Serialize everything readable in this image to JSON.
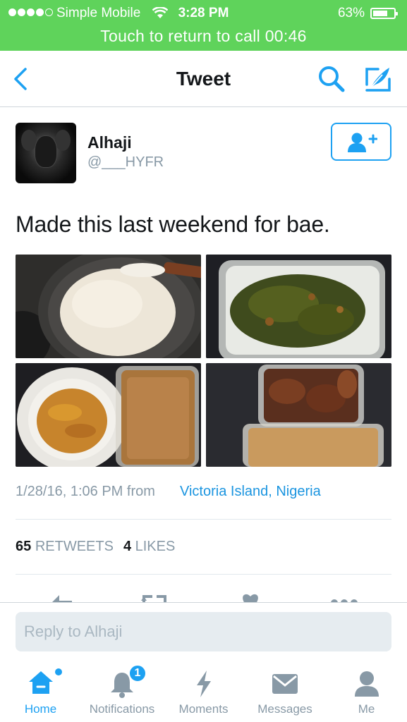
{
  "status_bar": {
    "carrier": "Simple Mobile",
    "time": "3:28 PM",
    "battery": "63%",
    "call_banner": "Touch to return to call  00:46"
  },
  "nav": {
    "title": "Tweet"
  },
  "tweet": {
    "user_name": "Alhaji",
    "user_handle": "@___HYFR",
    "text": "Made this last weekend for bae.",
    "timestamp": "1/28/16, 1:06 PM from",
    "location": "Victoria Island, Nigeria",
    "retweets_count": "65",
    "retweets_label": "RETWEETS",
    "likes_count": "4",
    "likes_label": "LIKES"
  },
  "reply": {
    "placeholder": "Reply to Alhaji"
  },
  "tab_bar": {
    "items": [
      {
        "label": "Home",
        "icon": "home-icon",
        "active": true
      },
      {
        "label": "Notifications",
        "icon": "bell-icon",
        "badge": "1"
      },
      {
        "label": "Moments",
        "icon": "lightning-icon"
      },
      {
        "label": "Messages",
        "icon": "envelope-icon"
      },
      {
        "label": "Me",
        "icon": "person-icon"
      }
    ]
  },
  "colors": {
    "status_bar_bg": "#5fd35b",
    "accent": "#1da1f2",
    "link": "#1b95e0",
    "muted": "#8899a6"
  }
}
